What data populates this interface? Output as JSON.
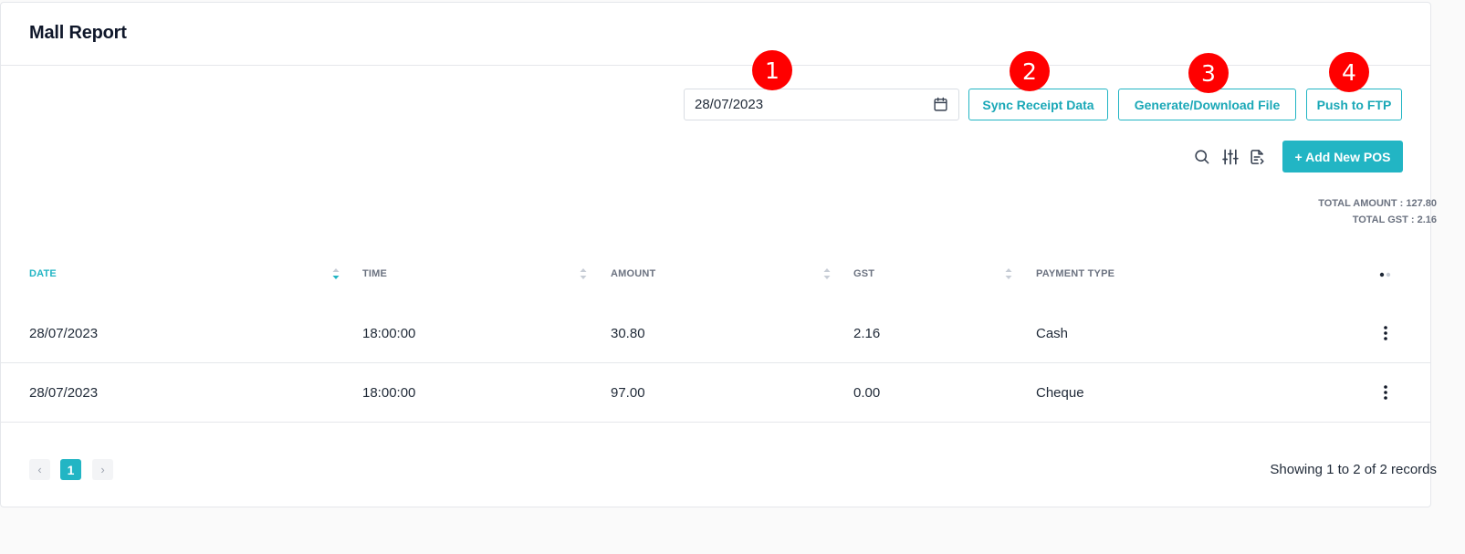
{
  "page": {
    "title": "Mall Report"
  },
  "filters": {
    "date_value": "28/07/2023"
  },
  "actions": {
    "sync_label": "Sync Receipt Data",
    "generate_label": "Generate/Download File",
    "ftp_label": "Push to FTP",
    "add_label": "+ Add New POS"
  },
  "markers": [
    "1",
    "2",
    "3",
    "4"
  ],
  "toolbar_icons": [
    "search-icon",
    "filter-sliders-icon",
    "export-file-icon"
  ],
  "totals": {
    "amount": "TOTAL AMOUNT : 127.80",
    "gst": "TOTAL GST : 2.16"
  },
  "table": {
    "headers": [
      "DATE",
      "TIME",
      "AMOUNT",
      "GST",
      "PAYMENT TYPE"
    ],
    "rows": [
      {
        "date": "28/07/2023",
        "time": "18:00:00",
        "amount": "30.80",
        "gst": "2.16",
        "payment": "Cash"
      },
      {
        "date": "28/07/2023",
        "time": "18:00:00",
        "amount": "97.00",
        "gst": "0.00",
        "payment": "Cheque"
      }
    ]
  },
  "pagination": {
    "prev": "‹",
    "current": "1",
    "next": "›",
    "summary": "Showing 1 to 2 of 2 records"
  },
  "colors": {
    "accent": "#22b5c4",
    "marker": "#ff0000",
    "muted_text": "#6b7280"
  }
}
